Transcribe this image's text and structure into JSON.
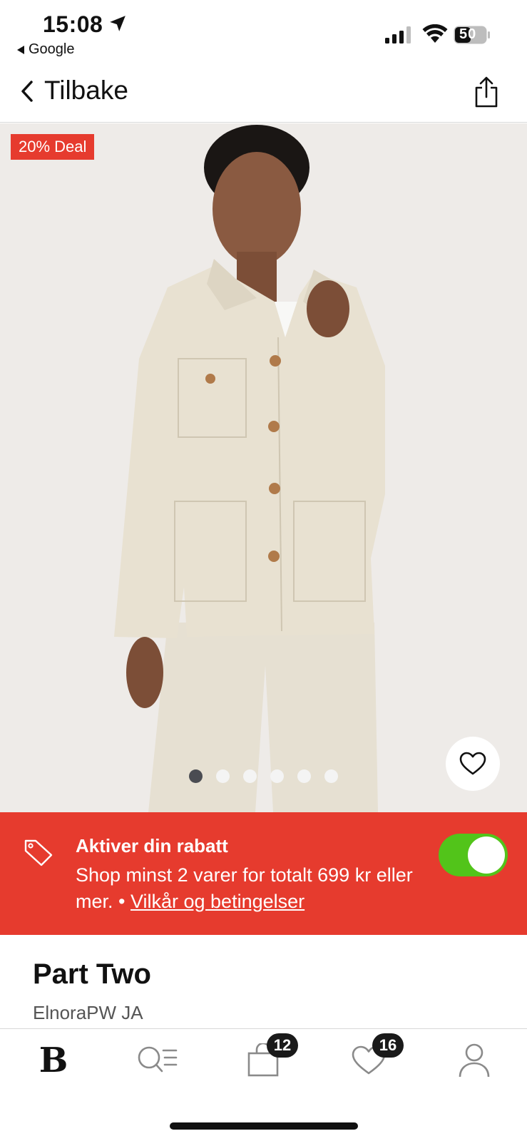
{
  "status_bar": {
    "time": "15:08",
    "back_app": "Google",
    "battery": "50"
  },
  "nav": {
    "back_label": "Tilbake"
  },
  "product_image": {
    "deal_badge": "20% Deal",
    "carousel_count": 6,
    "carousel_active": 1
  },
  "promo": {
    "title": "Aktiver din rabatt",
    "description": "Shop minst 2 varer for totalt 699 kr eller mer. •",
    "terms_link": "Vilkår og betingelser",
    "toggle_on": true,
    "color": "#e63b2e"
  },
  "product": {
    "brand": "Part Two",
    "name": "ElnoraPW JA"
  },
  "tab_bar": {
    "logo": "B",
    "cart_count": "12",
    "favorites_count": "16"
  }
}
